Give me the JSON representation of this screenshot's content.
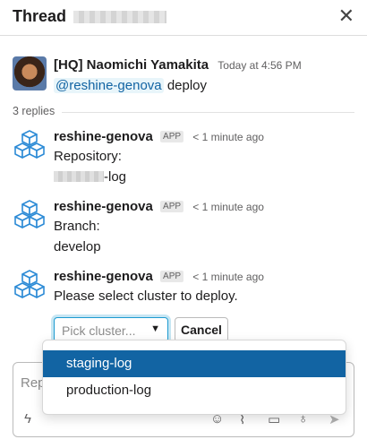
{
  "header": {
    "title": "Thread",
    "channel_name_redacted": "",
    "close_icon": "close-icon"
  },
  "parent_message": {
    "author": "[HQ] Naomichi Yamakita",
    "time": "Today at 4:56 PM",
    "mention": "@reshine-genova",
    "text": "deploy",
    "avatar": "user-photo"
  },
  "replies": {
    "count_label": "3 replies",
    "items": [
      {
        "author": "reshine-genova",
        "badge": "APP",
        "time": "< 1 minute ago",
        "line1": "Repository:",
        "line2_suffix": "-log"
      },
      {
        "author": "reshine-genova",
        "badge": "APP",
        "time": "< 1 minute ago",
        "line1": "Branch:",
        "line2": "develop"
      },
      {
        "author": "reshine-genova",
        "badge": "APP",
        "time": "< 1 minute ago",
        "line1": "Please select cluster to deploy."
      }
    ]
  },
  "cluster_picker": {
    "placeholder": "Pick cluster...",
    "chevron_icon": "chevron-down-icon",
    "cancel_label": "Cancel",
    "options": [
      {
        "label": "staging-log",
        "selected": true
      },
      {
        "label": "production-log",
        "selected": false
      }
    ]
  },
  "composer": {
    "placeholder_visible": "Rep",
    "toolbar_icons": [
      "lightning-icon",
      "emoji-icon",
      "attachment-icon",
      "video-icon",
      "microphone-icon",
      "send-icon"
    ]
  },
  "colors": {
    "link": "#1264a3",
    "selected_option_bg": "#1264a3",
    "focus_border": "#1d9bd1"
  }
}
